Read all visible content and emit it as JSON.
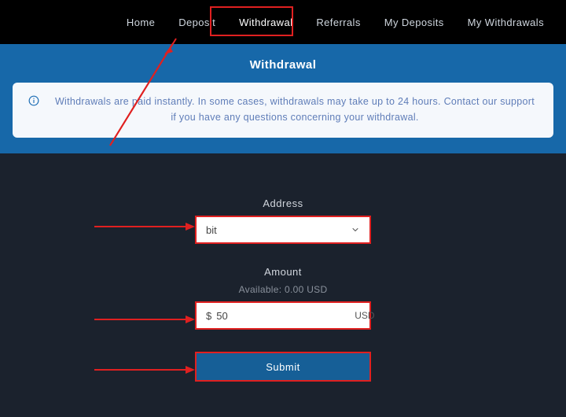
{
  "nav": {
    "items": [
      {
        "label": "Home"
      },
      {
        "label": "Deposit"
      },
      {
        "label": "Withdrawal"
      },
      {
        "label": "Referrals"
      },
      {
        "label": "My Deposits"
      },
      {
        "label": "My Withdrawals"
      }
    ],
    "active_index": 2
  },
  "banner": {
    "title": "Withdrawal",
    "info": "Withdrawals are paid instantly. In some cases, withdrawals may take up to 24 hours. Contact our support if you have any questions concerning your withdrawal."
  },
  "form": {
    "address": {
      "label": "Address",
      "selected": "bit"
    },
    "amount": {
      "label": "Amount",
      "available": "Available: 0.00 USD",
      "prefix": "$",
      "value": "50",
      "unit": "USD"
    },
    "submit_label": "Submit"
  }
}
